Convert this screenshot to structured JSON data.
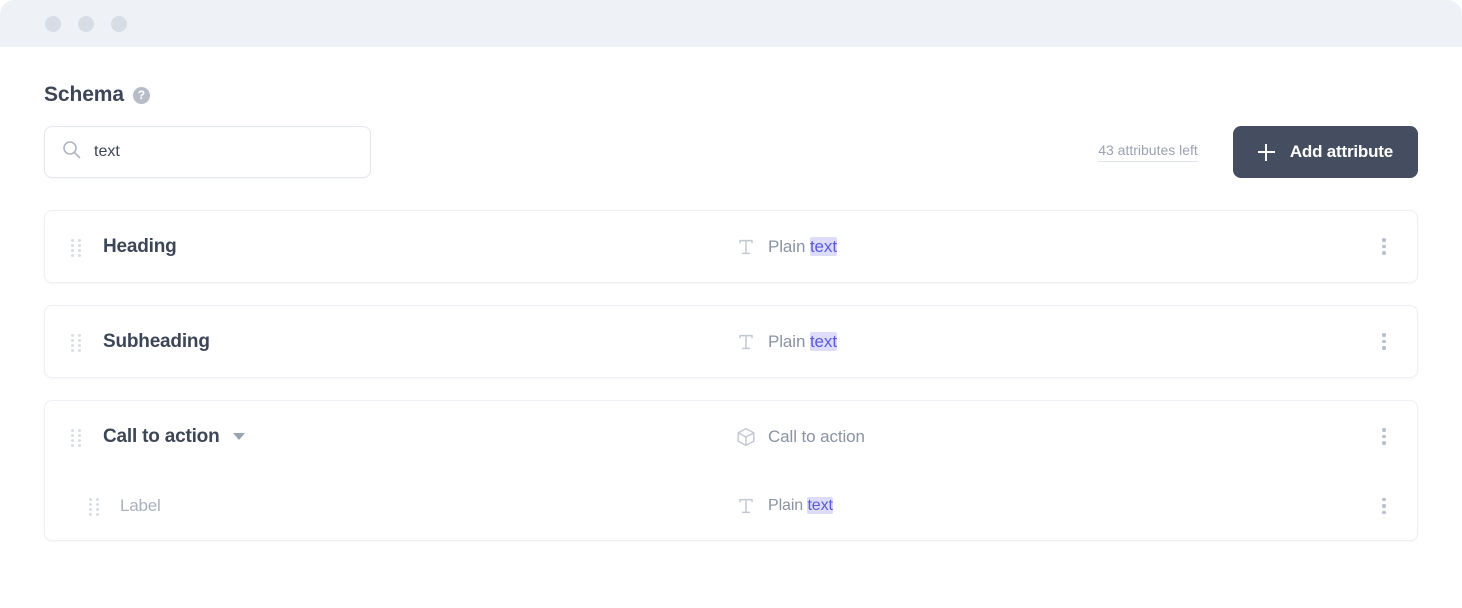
{
  "window": {
    "traffic_dots": [
      "dot-1",
      "dot-2",
      "dot-3"
    ]
  },
  "section": {
    "title": "Schema",
    "help_icon": "help-circle-icon",
    "help_glyph": "?"
  },
  "search": {
    "icon": "search-icon",
    "value": "text",
    "placeholder": "Search attributes"
  },
  "toolbar": {
    "attributes_left": "43 attributes left",
    "add_label": "Add attribute",
    "add_icon": "plus-icon"
  },
  "colors": {
    "accent_dark": "#454e60",
    "highlight_bg": "#dddcfb",
    "highlight_text": "#5b5ad6",
    "titlebar": "#eef2f6",
    "text_primary": "#3d4657",
    "text_muted": "#8a93a2"
  },
  "attributes": [
    {
      "name": "Heading",
      "type_icon": "plain-text-icon",
      "type_prefix": "Plain ",
      "type_match": "text",
      "type_suffix": "",
      "expandable": false,
      "children": []
    },
    {
      "name": "Subheading",
      "type_icon": "plain-text-icon",
      "type_prefix": "Plain ",
      "type_match": "text",
      "type_suffix": "",
      "expandable": false,
      "children": []
    },
    {
      "name": "Call to action",
      "type_icon": "object-cube-icon",
      "type_prefix": "Call to action",
      "type_match": "",
      "type_suffix": "",
      "expandable": true,
      "children": [
        {
          "name": "Label",
          "type_icon": "plain-text-icon",
          "type_prefix": "Plain ",
          "type_match": "text",
          "type_suffix": ""
        }
      ]
    }
  ],
  "row_menu_icon": "kebab-menu-icon",
  "drag_icon": "drag-handle-icon"
}
